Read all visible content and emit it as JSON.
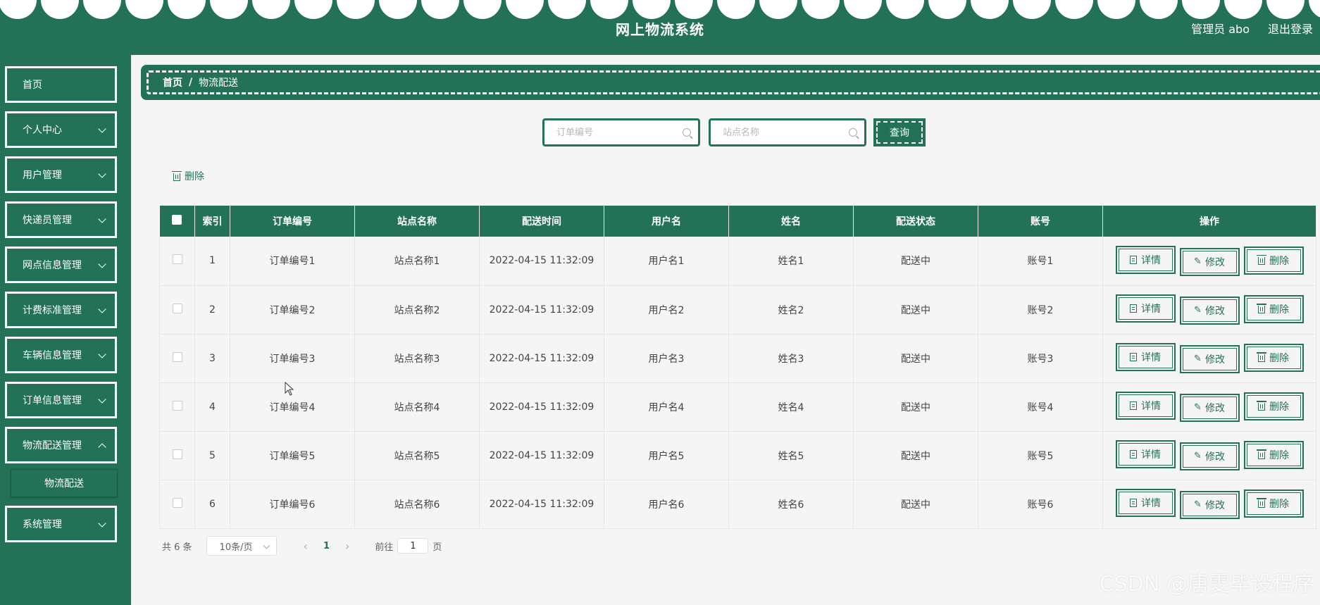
{
  "header": {
    "title": "网上物流系统",
    "user": "管理员 abo",
    "logout": "退出登录"
  },
  "sidebar": {
    "items": [
      {
        "label": "首页",
        "has_arrow": false
      },
      {
        "label": "个人中心",
        "has_arrow": true
      },
      {
        "label": "用户管理",
        "has_arrow": true
      },
      {
        "label": "快递员管理",
        "has_arrow": true
      },
      {
        "label": "网点信息管理",
        "has_arrow": true
      },
      {
        "label": "计费标准管理",
        "has_arrow": true
      },
      {
        "label": "车辆信息管理",
        "has_arrow": true
      },
      {
        "label": "订单信息管理",
        "has_arrow": true
      },
      {
        "label": "物流配送管理",
        "has_arrow": true
      },
      {
        "label": "系统管理",
        "has_arrow": true
      }
    ],
    "subitem": "物流配送"
  },
  "breadcrumb": {
    "home": "首页",
    "sep": "/",
    "current": "物流配送"
  },
  "search": {
    "order_placeholder": "订单编号",
    "station_placeholder": "站点名称",
    "query_label": "查询"
  },
  "toolbar": {
    "delete_label": "删除"
  },
  "table": {
    "headers": [
      "索引",
      "订单编号",
      "站点名称",
      "配送时间",
      "用户名",
      "姓名",
      "配送状态",
      "账号",
      "操作"
    ],
    "rows": [
      [
        "1",
        "订单编号1",
        "站点名称1",
        "2022-04-15 11:32:09",
        "用户名1",
        "姓名1",
        "配送中",
        "账号1"
      ],
      [
        "2",
        "订单编号2",
        "站点名称2",
        "2022-04-15 11:32:09",
        "用户名2",
        "姓名2",
        "配送中",
        "账号2"
      ],
      [
        "3",
        "订单编号3",
        "站点名称3",
        "2022-04-15 11:32:09",
        "用户名3",
        "姓名3",
        "配送中",
        "账号3"
      ],
      [
        "4",
        "订单编号4",
        "站点名称4",
        "2022-04-15 11:32:09",
        "用户名4",
        "姓名4",
        "配送中",
        "账号4"
      ],
      [
        "5",
        "订单编号5",
        "站点名称5",
        "2022-04-15 11:32:09",
        "用户名5",
        "姓名5",
        "配送中",
        "账号5"
      ],
      [
        "6",
        "订单编号6",
        "站点名称6",
        "2022-04-15 11:32:09",
        "用户名6",
        "姓名6",
        "配送中",
        "账号6"
      ]
    ],
    "actions": {
      "detail": "详情",
      "edit": "修改",
      "delete": "删除"
    }
  },
  "pagination": {
    "total": "共 6 条",
    "page_size": "10条/页",
    "current_page": "1",
    "goto_prefix": "前往",
    "goto_value": "1",
    "goto_suffix": "页"
  },
  "watermark": "CSDN @唐雯毕设程序",
  "colors": {
    "primary": "#237157",
    "background": "#f5f5f5"
  }
}
